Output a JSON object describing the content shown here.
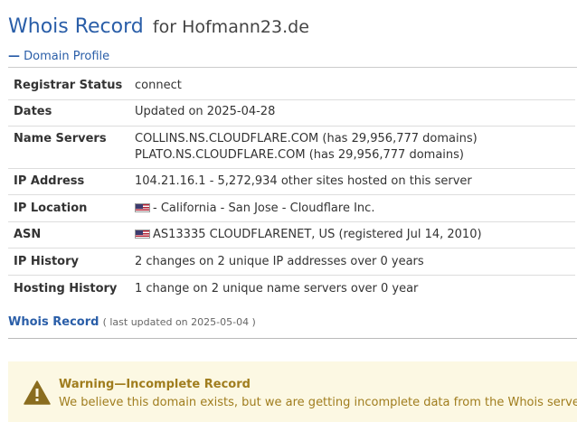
{
  "header": {
    "title": "Whois Record",
    "domain_suffix": "for Hofmann23.de"
  },
  "profile": {
    "section_label": "Domain Profile",
    "rows": [
      {
        "label": "Registrar Status",
        "lines": [
          "connect"
        ]
      },
      {
        "label": "Dates",
        "lines": [
          "Updated on 2025-04-28"
        ]
      },
      {
        "label": "Name Servers",
        "lines": [
          "COLLINS.NS.CLOUDFLARE.COM (has 29,956,777 domains)",
          "PLATO.NS.CLOUDFLARE.COM (has 29,956,777 domains)"
        ]
      },
      {
        "label": "IP Address",
        "lines": [
          "104.21.16.1 - 5,272,934 other sites hosted on this server"
        ]
      },
      {
        "label": "IP Location",
        "lines": [
          "- California - San Jose - Cloudflare Inc."
        ],
        "flag": "us-flag-icon"
      },
      {
        "label": "ASN",
        "lines": [
          "AS13335 CLOUDFLARENET, US (registered Jul 14, 2010)"
        ],
        "flag": "us-flag-icon"
      },
      {
        "label": "IP History",
        "lines": [
          "2 changes on 2 unique IP addresses over 0 years"
        ]
      },
      {
        "label": "Hosting History",
        "lines": [
          "1 change on 2 unique name servers over 0 year"
        ]
      }
    ]
  },
  "whois_record": {
    "link_label": "Whois Record",
    "updated_text": "( last updated on 2025-05-04 )"
  },
  "warning": {
    "icon": "warning-triangle-icon",
    "title": "Warning—Incomplete Record",
    "text": "We believe this domain exists, but we are getting incomplete data from the Whois server."
  },
  "colors": {
    "accent": "#2a5ea8",
    "warning_bg": "#fcf8e3",
    "warning_text": "#a07d1e"
  }
}
